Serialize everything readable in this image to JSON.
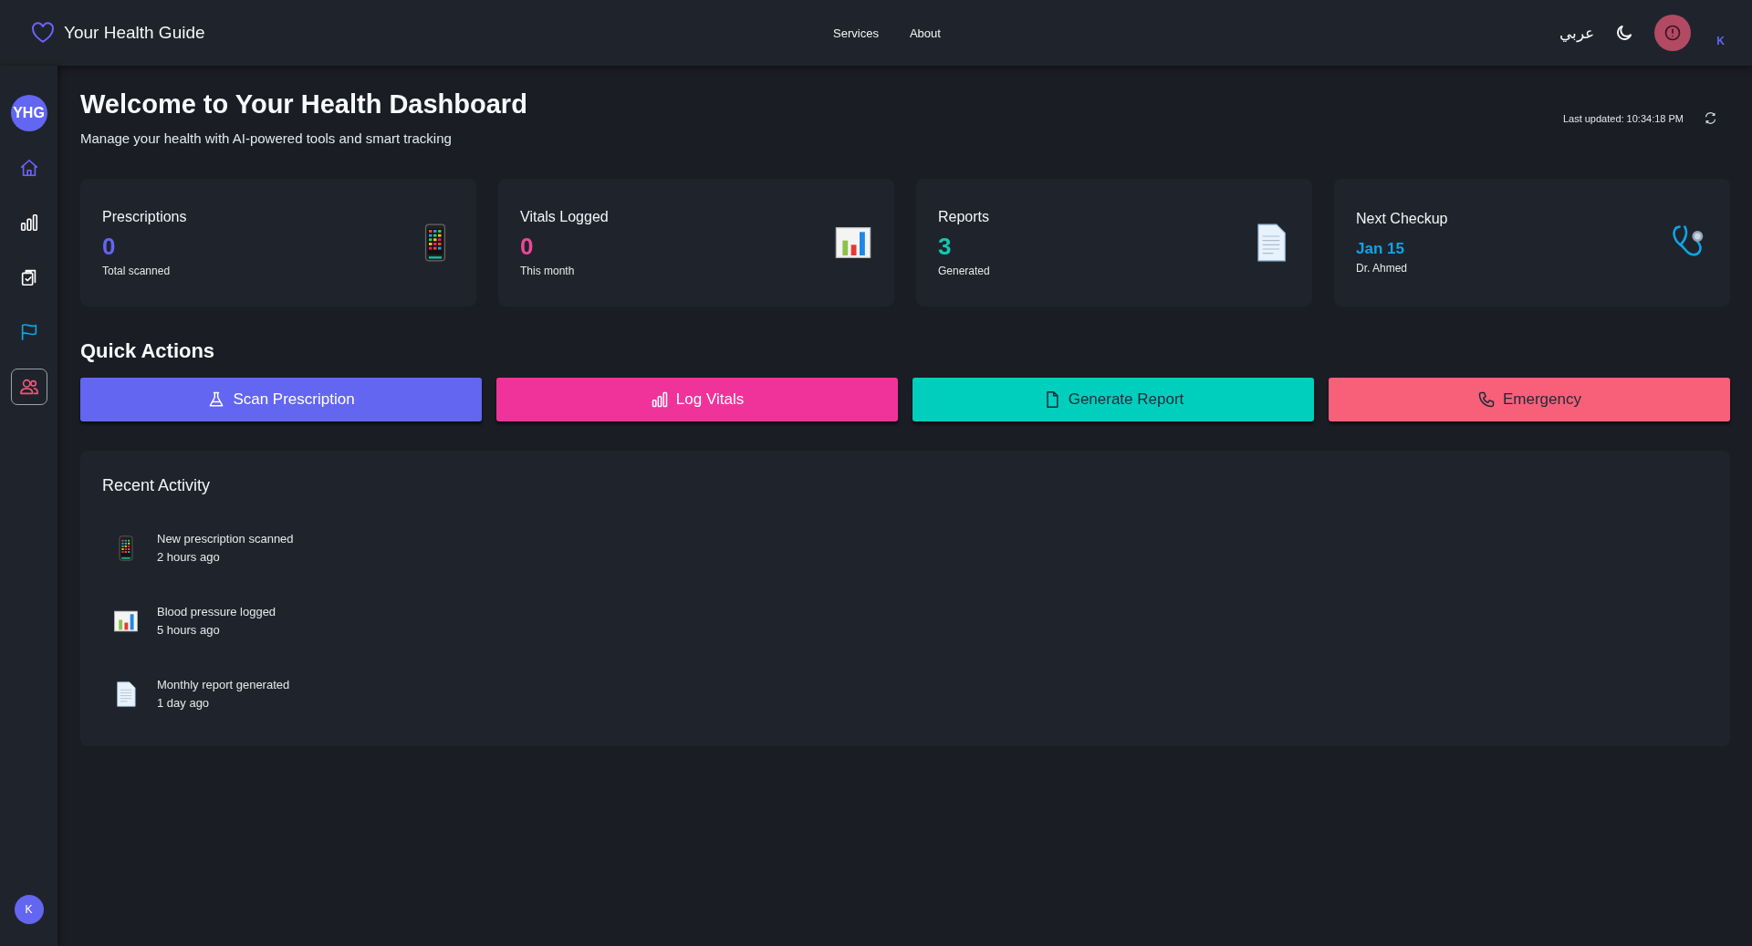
{
  "header": {
    "brand": "Your Health Guide",
    "nav": [
      "Services",
      "About"
    ],
    "language": "عربي",
    "user_initial": "K"
  },
  "sidebar": {
    "logo": "YHG",
    "items": [
      {
        "kind": "home",
        "color": "#6c63ff",
        "selected": false
      },
      {
        "kind": "chart",
        "color": "#ffffff",
        "selected": false
      },
      {
        "kind": "clipboard",
        "color": "#ffffff",
        "selected": false
      },
      {
        "kind": "flag",
        "color": "#0ea5e9",
        "selected": false
      },
      {
        "kind": "people",
        "color": "#f0567a",
        "selected": true
      }
    ],
    "user_initial": "K"
  },
  "page": {
    "title": "Welcome to Your Health Dashboard",
    "subtitle": "Manage your health with AI-powered tools and smart tracking",
    "last_updated": "Last updated: 10:34:18 PM"
  },
  "stats": [
    {
      "label": "Prescriptions",
      "value": "0",
      "caption": "Total scanned",
      "color": "#6366f1",
      "kind": "mobile"
    },
    {
      "label": "Vitals Logged",
      "value": "0",
      "caption": "This month",
      "color": "#ec4899",
      "kind": "barchart"
    },
    {
      "label": "Reports",
      "value": "3",
      "caption": "Generated",
      "color": "#14c8b0",
      "kind": "document"
    },
    {
      "label": "Next Checkup",
      "value": "Jan 15",
      "caption": "Dr. Ahmed",
      "color": "#0ea5e9",
      "kind": "stethoscope"
    }
  ],
  "quick_actions": {
    "title": "Quick Actions",
    "buttons": [
      {
        "label": "Scan Prescription",
        "kind": "flask",
        "color": "#6366f1"
      },
      {
        "label": "Log Vitals",
        "kind": "bars",
        "color": "#f0339a"
      },
      {
        "label": "Generate Report",
        "kind": "file",
        "color": "#00cfbd"
      },
      {
        "label": "Emergency",
        "kind": "phone",
        "color": "#f85f78"
      }
    ]
  },
  "recent_activity": {
    "title": "Recent Activity",
    "items": [
      {
        "kind": "mobile",
        "text": "New prescription scanned",
        "time": "2 hours ago"
      },
      {
        "kind": "barchart",
        "text": "Blood pressure logged",
        "time": "5 hours ago"
      },
      {
        "kind": "document",
        "text": "Monthly report generated",
        "time": "1 day ago"
      }
    ]
  }
}
